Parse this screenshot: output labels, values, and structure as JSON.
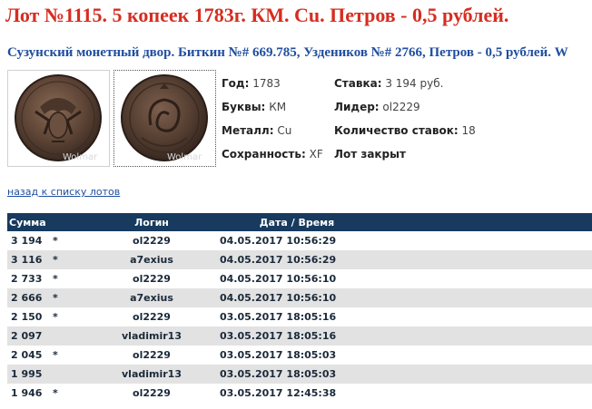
{
  "lot": {
    "title": "Лот №1115.  5 копеек 1783г. КМ. Cu. Петров - 0,5 рублей.",
    "subtitle": "Сузунский монетный двор. Биткин №# 669.785, Уздеников №# 2766, Петров - 0,5 рублей. W"
  },
  "images": {
    "watermark": "Wolmar"
  },
  "details": {
    "year_label": "Год:",
    "year_value": "1783",
    "letters_label": "Буквы:",
    "letters_value": "КМ",
    "metal_label": "Металл:",
    "metal_value": "Cu",
    "condition_label": "Сохранность:",
    "condition_value": "XF",
    "bid_label": "Ставка:",
    "bid_value": "3 194 руб.",
    "leader_label": "Лидер:",
    "leader_value": "ol2229",
    "count_label": "Количество ставок:",
    "count_value": "18",
    "status": "Лот закрыт"
  },
  "nav": {
    "back_link": "назад к списку лотов"
  },
  "bids": {
    "headers": {
      "sum": "Сумма",
      "login": "Логин",
      "datetime": "Дата / Время"
    },
    "rows": [
      {
        "sum": "3 194",
        "star": "*",
        "login": "ol2229",
        "datetime": "04.05.2017 10:56:29"
      },
      {
        "sum": "3 116",
        "star": "*",
        "login": "a7exius",
        "datetime": "04.05.2017 10:56:29"
      },
      {
        "sum": "2 733",
        "star": "*",
        "login": "ol2229",
        "datetime": "04.05.2017 10:56:10"
      },
      {
        "sum": "2 666",
        "star": "*",
        "login": "a7exius",
        "datetime": "04.05.2017 10:56:10"
      },
      {
        "sum": "2 150",
        "star": "*",
        "login": "ol2229",
        "datetime": "03.05.2017 18:05:16"
      },
      {
        "sum": "2 097",
        "star": "",
        "login": "vladimir13",
        "datetime": "03.05.2017 18:05:16"
      },
      {
        "sum": "2 045",
        "star": "*",
        "login": "ol2229",
        "datetime": "03.05.2017 18:05:03"
      },
      {
        "sum": "1 995",
        "star": "",
        "login": "vladimir13",
        "datetime": "03.05.2017 18:05:03"
      },
      {
        "sum": "1 946",
        "star": "*",
        "login": "ol2229",
        "datetime": "03.05.2017 12:45:38"
      }
    ]
  },
  "colors": {
    "title": "#d62d20",
    "subtitle": "#1f4e9e",
    "header_bg": "#173a5e",
    "row_alt": "#e2e2e2"
  }
}
